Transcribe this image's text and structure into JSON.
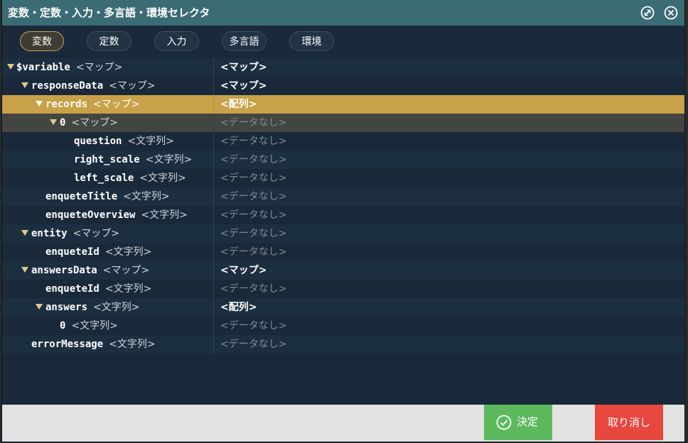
{
  "window": {
    "title": "変数・定数・入力・多言語・環境セレクタ"
  },
  "tabs": [
    {
      "label": "変数",
      "active": true
    },
    {
      "label": "定数",
      "active": false
    },
    {
      "label": "入力",
      "active": false
    },
    {
      "label": "多言語",
      "active": false
    },
    {
      "label": "環境",
      "active": false
    }
  ],
  "tree": {
    "rows": [
      {
        "name": "$variable",
        "type": "<マップ>",
        "value": "<マップ>",
        "expanded": true,
        "selected": false
      },
      {
        "name": "responseData",
        "type": "<マップ>",
        "value": "<マップ>",
        "expanded": true,
        "selected": false
      },
      {
        "name": "records",
        "type": "<マップ>",
        "value": "<配列>",
        "expanded": true,
        "selected": true
      },
      {
        "name": "0",
        "type": "<マップ>",
        "value": "<データなし>",
        "expanded": true,
        "selected": false
      },
      {
        "name": "question",
        "type": "<文字列>",
        "value": "<データなし>"
      },
      {
        "name": "right_scale",
        "type": "<文字列>",
        "value": "<データなし>"
      },
      {
        "name": "left_scale",
        "type": "<文字列>",
        "value": "<データなし>"
      },
      {
        "name": "enqueteTitle",
        "type": "<文字列>",
        "value": "<データなし>"
      },
      {
        "name": "enqueteOverview",
        "type": "<文字列>",
        "value": "<データなし>"
      },
      {
        "name": "entity",
        "type": "<マップ>",
        "value": "<データなし>",
        "expanded": true
      },
      {
        "name": "enqueteId",
        "type": "<文字列>",
        "value": "<データなし>"
      },
      {
        "name": "answersData",
        "type": "<マップ>",
        "value": "<マップ>",
        "expanded": true
      },
      {
        "name": "enqueteId",
        "type": "<文字列>",
        "value": "<データなし>"
      },
      {
        "name": "answers",
        "type": "<文字列>",
        "value": "<配列>",
        "expanded": true
      },
      {
        "name": "0",
        "type": "<文字列>",
        "value": "<データなし>"
      },
      {
        "name": "errorMessage",
        "type": "<文字列>",
        "value": "<データなし>"
      }
    ]
  },
  "footer": {
    "ok_label": "決定",
    "cancel_label": "取り消し"
  },
  "colors": {
    "accent": "#c9a148",
    "ok": "#5cb95e",
    "cancel": "#e8473e",
    "titlebar": "#3b6b74"
  }
}
